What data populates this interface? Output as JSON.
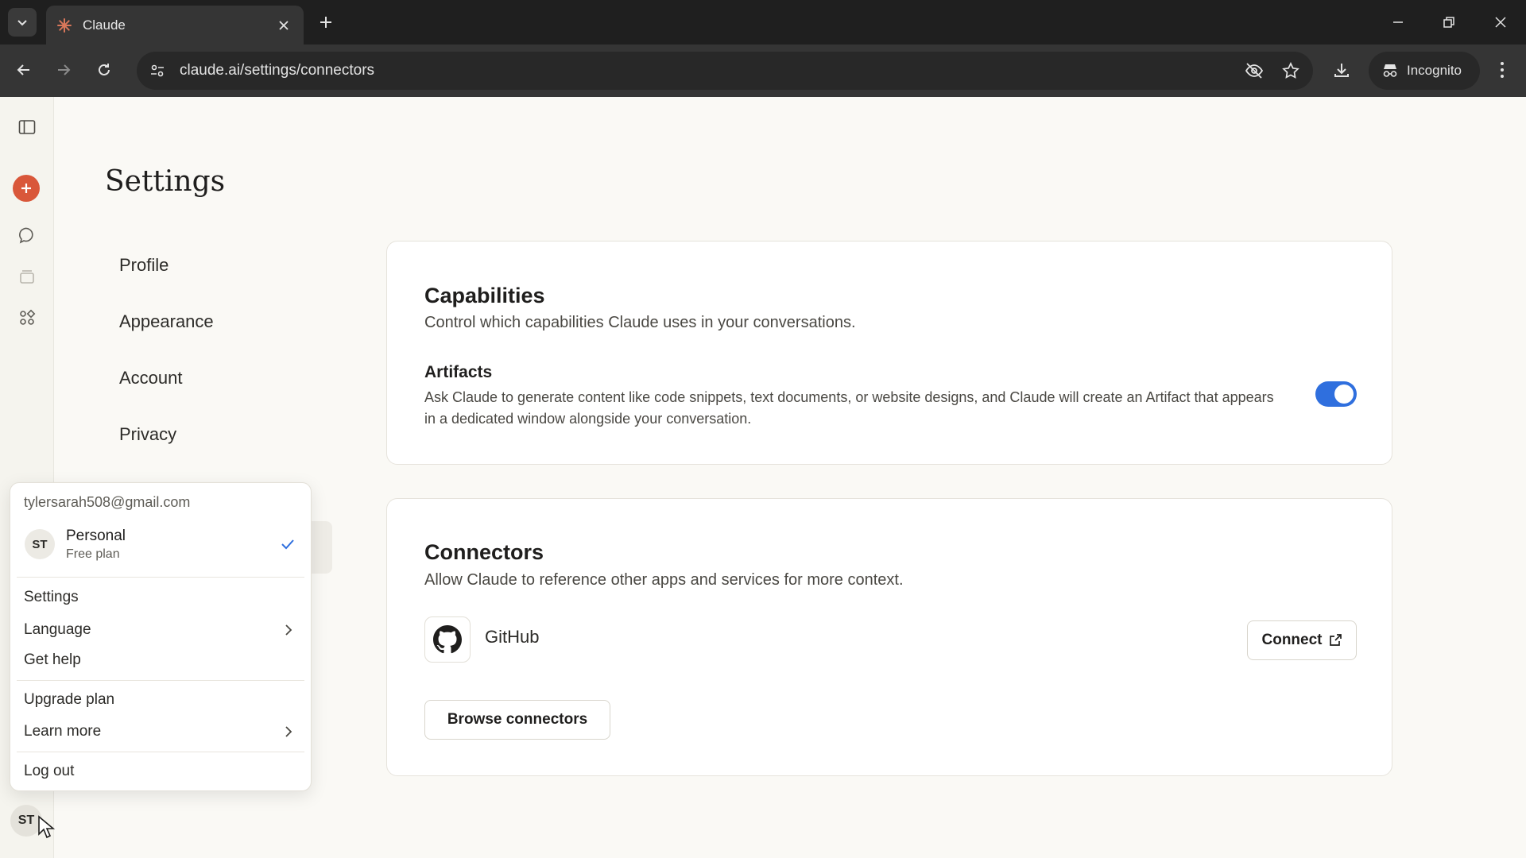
{
  "browser": {
    "tab_title": "Claude",
    "url": "claude.ai/settings/connectors",
    "incognito_label": "Incognito"
  },
  "settings": {
    "title": "Settings",
    "nav": [
      "Profile",
      "Appearance",
      "Account",
      "Privacy"
    ]
  },
  "capabilities": {
    "title": "Capabilities",
    "subtitle": "Control which capabilities Claude uses in your conversations.",
    "artifacts_title": "Artifacts",
    "artifacts_desc": "Ask Claude to generate content like code snippets, text documents, or website designs, and Claude will create an Artifact that appears in a dedicated window alongside your conversation.",
    "artifacts_enabled": true
  },
  "connectors": {
    "title": "Connectors",
    "subtitle": "Allow Claude to reference other apps and services for more context.",
    "github_label": "GitHub",
    "connect_label": "Connect",
    "browse_label": "Browse connectors"
  },
  "account_menu": {
    "email": "tylersarah508@gmail.com",
    "initials": "ST",
    "account_name": "Personal",
    "account_plan": "Free plan",
    "settings": "Settings",
    "language": "Language",
    "get_help": "Get help",
    "upgrade_plan": "Upgrade plan",
    "learn_more": "Learn more",
    "log_out": "Log out"
  },
  "user": {
    "initials": "ST"
  },
  "colors": {
    "brand": "#d9573a",
    "toggle_on": "#2f6fde"
  }
}
